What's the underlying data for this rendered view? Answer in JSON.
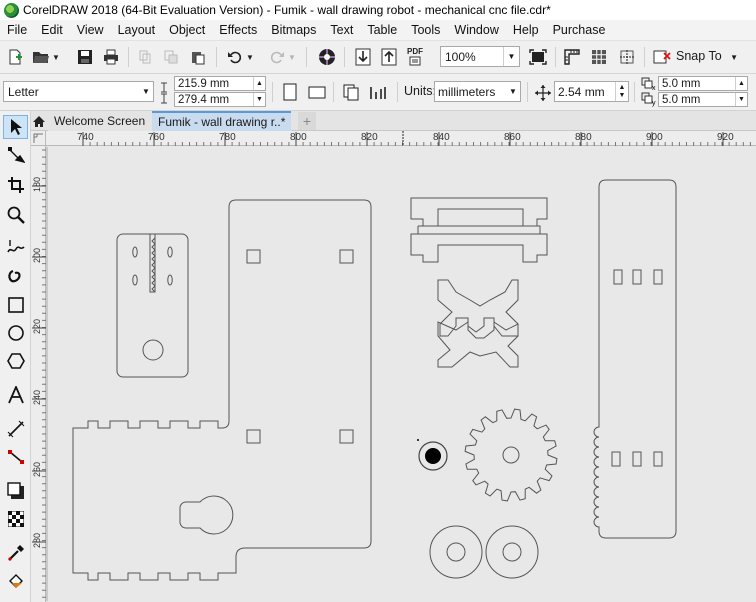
{
  "titlebar": {
    "title": "CorelDRAW 2018 (64-Bit Evaluation Version) - Fumik - wall drawing robot - mechanical cnc file.cdr*"
  },
  "menubar": {
    "items": [
      {
        "label": "File"
      },
      {
        "label": "Edit"
      },
      {
        "label": "View"
      },
      {
        "label": "Layout"
      },
      {
        "label": "Object"
      },
      {
        "label": "Effects"
      },
      {
        "label": "Bitmaps"
      },
      {
        "label": "Text"
      },
      {
        "label": "Table"
      },
      {
        "label": "Tools"
      },
      {
        "label": "Window"
      },
      {
        "label": "Help"
      },
      {
        "label": "Purchase"
      }
    ]
  },
  "toolbar": {
    "zoom_level": "100%",
    "snap_label": "Snap To",
    "pdf_label": "PDF"
  },
  "property_bar": {
    "page_size": "Letter",
    "page_width": "215.9 mm",
    "page_height": "279.4 mm",
    "units_label": "Units:",
    "units_value": "millimeters",
    "nudge_distance": "2.54 mm",
    "duplicate_x": "5.0 mm",
    "duplicate_y": "5.0 mm"
  },
  "tabs": [
    {
      "label": "Welcome Screen",
      "active": false
    },
    {
      "label": "Fumik - wall drawing r..*",
      "active": true
    }
  ],
  "rulers": {
    "horizontal_ticks": [
      "740",
      "760",
      "780",
      "800",
      "820",
      "840",
      "860",
      "880",
      "900",
      "920"
    ],
    "vertical_ticks": [
      "180",
      "200",
      "220",
      "240",
      "260",
      "280"
    ]
  },
  "colors": {
    "canvas": "#e8e8e8",
    "outline": "#555555",
    "active_tab": "#c9dbef",
    "accent": "#5b9bd5"
  },
  "icons": [
    "arrow-pointer-icon",
    "shape-icon",
    "crop-icon",
    "zoom-icon",
    "freehand-icon",
    "artistic-media-icon",
    "rectangle-icon",
    "ellipse-icon",
    "polygon-icon",
    "text-icon",
    "parallel-dimension-icon",
    "connector-icon",
    "drop-shadow-icon",
    "transparency-icon",
    "eyedropper-icon",
    "interactive-fill-icon"
  ]
}
